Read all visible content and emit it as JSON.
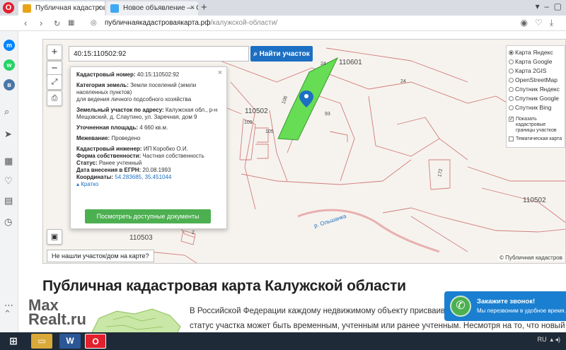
{
  "browser": {
    "tabs": [
      {
        "title": "Публичная кадастровая к",
        "favicon_color": "#e8a419"
      },
      {
        "title": "Новое объявление — Об",
        "favicon_color": "#3fa9f5"
      }
    ],
    "url_host": "публичнаякадастроваякарта.рф",
    "url_path": "/калужской-области/"
  },
  "map": {
    "search_value": "40:15:110502:92",
    "find_button": "Найти участок",
    "notfound_button": "Не нашли участок/дом на карте?",
    "copyright": "© Публичная кадастров",
    "labels": [
      "110601",
      "110502",
      "110502",
      "110503",
      "24",
      "93",
      "106",
      "109",
      "105",
      "172",
      "2",
      "р. Ольшанка",
      "24"
    ],
    "layers": [
      {
        "label": "Карта Яндекс",
        "selected": true
      },
      {
        "label": "Карта Google",
        "selected": false
      },
      {
        "label": "Карта 2GIS",
        "selected": false
      },
      {
        "label": "OpenStreetMap",
        "selected": false
      },
      {
        "label": "Спутник Яндекс",
        "selected": false
      },
      {
        "label": "Спутник Google",
        "selected": false
      },
      {
        "label": "Спутник Bing",
        "selected": false
      }
    ],
    "show_borders": "Показать кадастровые границы участков",
    "thematic_map": "Тематическая карта"
  },
  "info": {
    "cadastral_number_label": "Кадастровый номер:",
    "cadastral_number": "40:15:110502:92",
    "land_category_label": "Категория земель:",
    "land_category": "Земли поселений (земли населенных пунктов)",
    "land_use": "для ведения личного подсобного хозяйства",
    "address_label": "Земельный участок по адресу:",
    "address": "Калужская обл., р-н Мещовский, д. Слаутино, ул. Заречная, дом 9",
    "area_label": "Уточненная площадь:",
    "area": "4 660 кв.м.",
    "survey_label": "Межевание:",
    "survey": "Проведено",
    "engineer_label": "Кадастровый инженер:",
    "engineer": "ИП Коробко О.И.",
    "ownership_label": "Форма собственности:",
    "ownership": "Частная собственность",
    "status_label": "Статус:",
    "status": "Ранее учтенный",
    "egrn_date_label": "Дата внесения в ЕГРН:",
    "egrn_date": "20.08.1993",
    "coords_label": "Координаты:",
    "coords": "54.283685, 35.451044",
    "collapse_link": "Кратко",
    "docs_button": "Посмотреть доступные документы"
  },
  "page": {
    "heading": "Публичная кадастровая карта Калужской области",
    "para1": "В Российской Федерации каждому недвижимому объекту присваива",
    "para2": "статус участка может быть временным, учтенным или ранее учтенным. Несмотря на то, что новый за",
    "callback_title": "Закажите звонок!",
    "callback_sub": "Мы перезвоним в удобное время.",
    "watermark_line1": "Max",
    "watermark_line2": "Realt.ru"
  },
  "taskbar": {
    "tray_lang": "RU"
  },
  "colors": {
    "selected_parcel": "#66dd55",
    "accent_blue": "#1d6fc3",
    "button_green": "#4caf50"
  }
}
